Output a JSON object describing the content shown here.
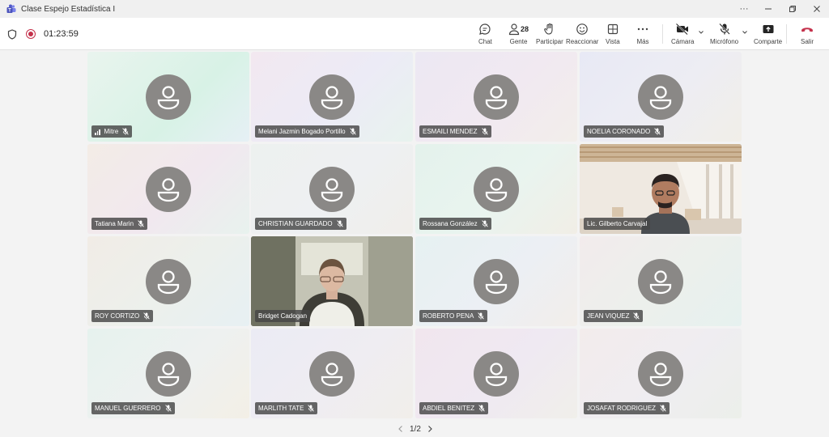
{
  "window": {
    "title": "Clase Espejo Estadística I"
  },
  "status": {
    "timer": "01:23:59"
  },
  "toolbar": {
    "chat": "Chat",
    "people": "Gente",
    "people_count": "28",
    "raise": "Participar",
    "react": "Reaccionar",
    "view": "Vista",
    "more": "Más",
    "camera": "Cámara",
    "mic": "Micrófono",
    "share": "Comparte",
    "leave": "Salir"
  },
  "participants": [
    {
      "name": "Mitre",
      "video": false,
      "signal": true
    },
    {
      "name": "Melani Jazmin Bogado Portillo",
      "video": false
    },
    {
      "name": "ESMAILI MENDEZ",
      "video": false
    },
    {
      "name": "NOELIA CORONADO",
      "video": false
    },
    {
      "name": "Tatiana Marin",
      "video": false
    },
    {
      "name": "CHRISTIAN GUARDADO",
      "video": false
    },
    {
      "name": "Rossana González",
      "video": false
    },
    {
      "name": "Lic. Gilberto Carvajal",
      "video": true,
      "active": true
    },
    {
      "name": "ROY CORTIZO",
      "video": false
    },
    {
      "name": "Bridget Cadogan",
      "video": true
    },
    {
      "name": "ROBERTO PENA",
      "video": false
    },
    {
      "name": "JEAN VIQUEZ",
      "video": false
    },
    {
      "name": "MANUEL GUERRERO",
      "video": false
    },
    {
      "name": "MARLITH TATE",
      "video": false
    },
    {
      "name": "ABDIEL BENITEZ",
      "video": false
    },
    {
      "name": "JOSAFAT RODRIGUEZ",
      "video": false
    }
  ],
  "pager": {
    "label": "1/2"
  },
  "colors": {
    "accent": "#6264a7",
    "record": "#c4314b",
    "leave": "#c4314b",
    "avatar": "#8a8886"
  }
}
